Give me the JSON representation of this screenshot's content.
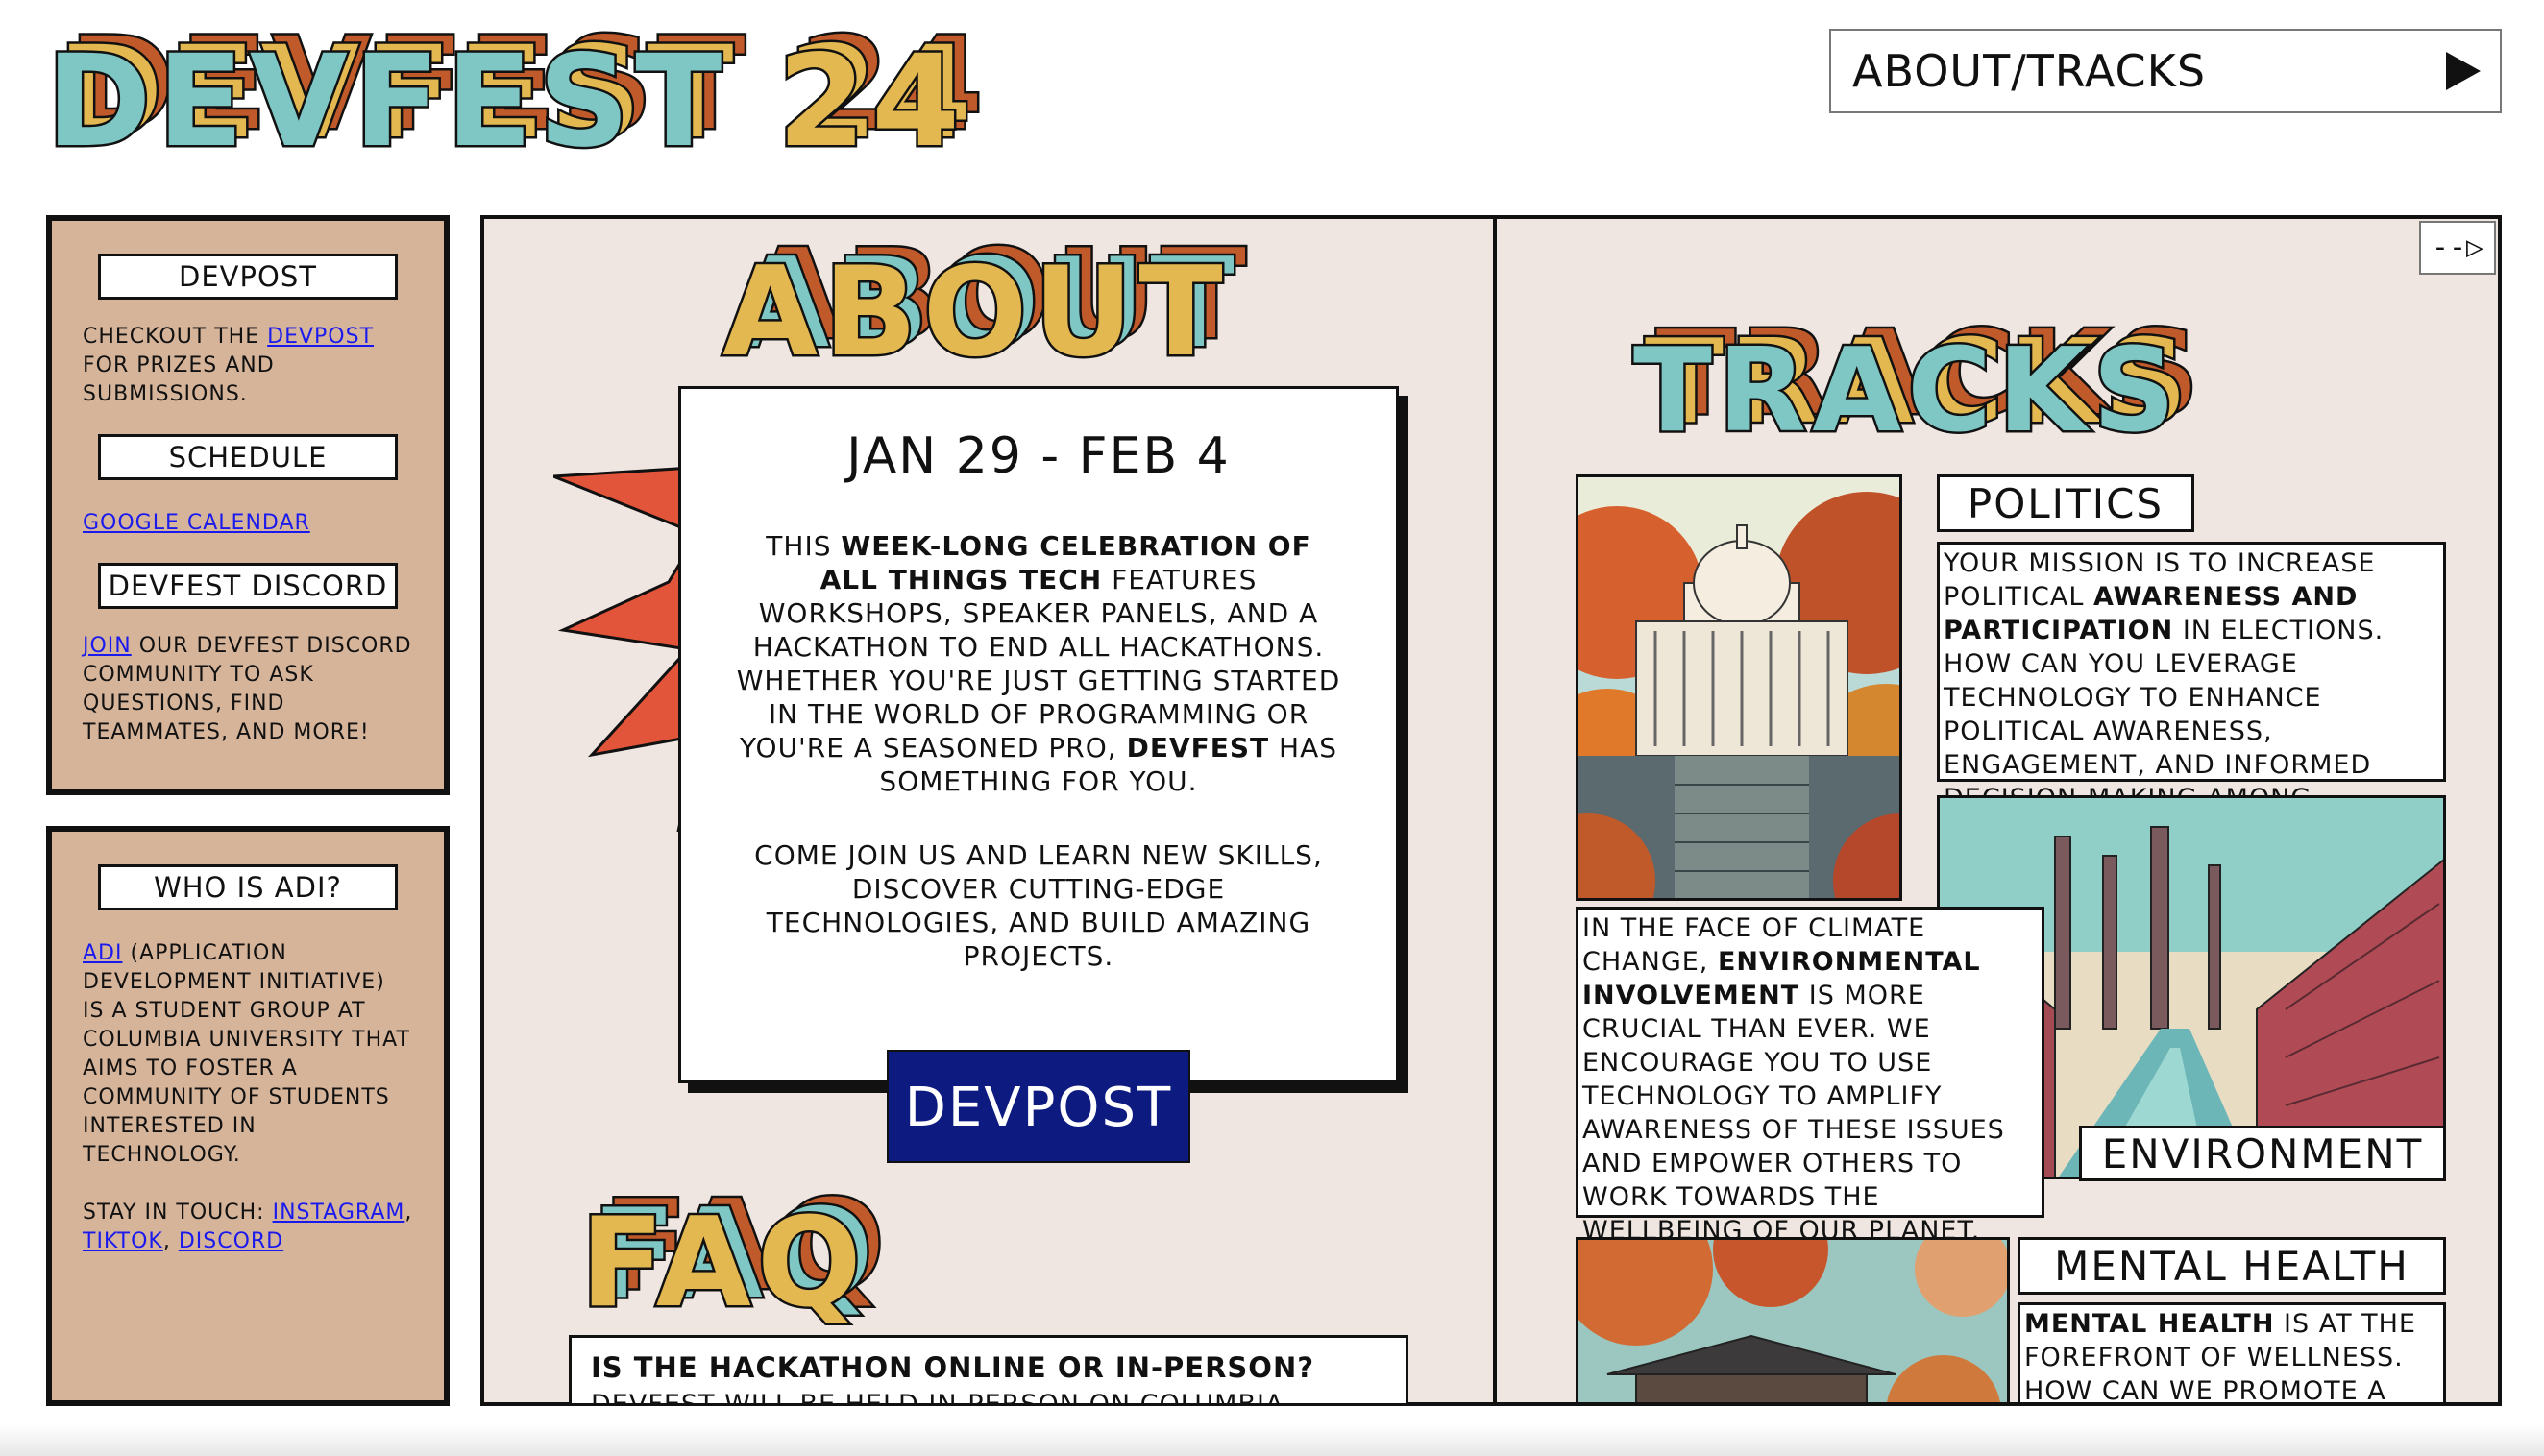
{
  "site": {
    "title": "DEVFEST",
    "year": "24"
  },
  "nav": {
    "label": "ABOUT/TRACKS"
  },
  "sidebar": {
    "devpost": {
      "heading": "DEVPOST",
      "text_before": "CHECKOUT THE ",
      "link": "DEVPOST",
      "text_after": " FOR PRIZES AND SUBMISSIONS."
    },
    "schedule": {
      "heading": "SCHEDULE",
      "link": "GOOGLE CALENDAR"
    },
    "discord": {
      "heading": "DEVFEST DISCORD",
      "link": "JOIN",
      "text_after": " OUR DEVFEST DISCORD COMMUNITY TO ASK QUESTIONS, FIND TEAMMATES, AND MORE!"
    },
    "adi": {
      "heading": "WHO IS ADI?",
      "link": "ADI",
      "text_after": " (APPLICATION DEVELOPMENT INITIATIVE) IS A STUDENT GROUP AT COLUMBIA UNIVERSITY THAT AIMS TO FOSTER A COMMUNITY OF STUDENTS INTERESTED IN TECHNOLOGY.",
      "stay_in_touch": "STAY IN TOUCH: ",
      "links": [
        "INSTAGRAM",
        "TIKTOK",
        "DISCORD"
      ],
      "sep": ", "
    }
  },
  "about": {
    "title": "ABOUT",
    "date": "JAN 29 - FEB 4",
    "body_1": "THIS ",
    "body_bold_1": "WEEK-LONG CELEBRATION OF ALL THINGS TECH",
    "body_2": " FEATURES WORKSHOPS, SPEAKER PANELS, AND A HACKATHON TO END ALL HACKATHONS. WHETHER YOU'RE JUST GETTING STARTED IN THE WORLD OF PROGRAMMING OR YOU'RE A SEASONED PRO, ",
    "body_bold_2": "DEVFEST",
    "body_3": " HAS SOMETHING FOR YOU.",
    "body_para2": "COME JOIN US AND LEARN NEW SKILLS, DISCOVER CUTTING-EDGE TECHNOLOGIES, AND BUILD AMAZING PROJECTS.",
    "button": "DEVPOST"
  },
  "faq": {
    "title": "FAQ",
    "question": "IS THE HACKATHON ONLINE OR IN-PERSON?",
    "answer": "DEVFEST WILL BE HELD IN-PERSON ON COLUMBIA"
  },
  "tracks": {
    "title": "TRACKS",
    "next": "--▷",
    "politics": {
      "label": "POLITICS",
      "d1": "YOUR MISSION IS TO INCREASE POLITICAL ",
      "b1": "AWARENESS AND PARTICIPATION",
      "d2": " IN ELECTIONS. HOW CAN YOU LEVERAGE TECHNOLOGY TO ENHANCE POLITICAL AWARENESS, ENGAGEMENT, AND INFORMED DECISION-MAKING AMONG CITIZENS?"
    },
    "environment": {
      "label": "ENVIRONMENT",
      "d1": "IN THE FACE OF CLIMATE CHANGE, ",
      "b1": "ENVIRONMENTAL INVOLVEMENT",
      "d2": " IS MORE CRUCIAL THAN EVER. WE ENCOURAGE YOU TO USE TECHNOLOGY TO AMPLIFY AWARENESS OF THESE ISSUES AND EMPOWER OTHERS TO WORK TOWARDS THE WELLBEING OF OUR PLANET."
    },
    "mental_health": {
      "label": "MENTAL HEALTH",
      "b1": "MENTAL HEALTH",
      "d2": " IS AT THE FOREFRONT OF WELLNESS. HOW CAN WE PROMOTE A"
    }
  },
  "colors": {
    "teal": "#7ec7c5",
    "gold": "#e3b850",
    "rust": "#c15a2b",
    "tan": "#d6b49a",
    "panel": "#efe6e2",
    "navy": "#0d1a80"
  },
  "icons": {
    "nav_arrow": "play-triangle-icon",
    "next": "next-arrow-icon"
  }
}
